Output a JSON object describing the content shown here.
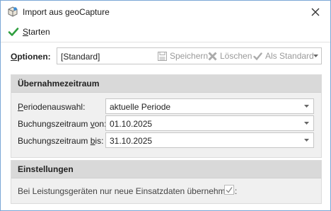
{
  "window": {
    "title": "Import aus geoCapture",
    "close_icon": "close-icon"
  },
  "toolbar": {
    "start_label_first": "S",
    "start_label_rest": "tarten",
    "start_icon": "checkmark-icon"
  },
  "options": {
    "label_first": "O",
    "label_rest": "ptionen:",
    "value": "[Standard]",
    "save_label": "Speichern",
    "delete_label": "Löschen",
    "default_label": "Als Standard"
  },
  "period_group": {
    "title": "Übernahmezeitraum",
    "period_label_first": "P",
    "period_label_rest": "eriodenauswahl:",
    "period_value": "aktuelle Periode",
    "from_label_pre": "Buchungszeitraum ",
    "from_label_u": "v",
    "from_label_post": "on:",
    "from_value": "01.10.2025",
    "to_label_pre": "Buchungszeitraum ",
    "to_label_u": "b",
    "to_label_post": "is:",
    "to_value": "31.10.2025"
  },
  "settings_group": {
    "title": "Einstellungen",
    "checkbox_label": "Bei Leistungsgeräten nur neue Einsatzdaten übernehmen:",
    "checkbox_checked": true
  },
  "colors": {
    "accent_green": "#2e9e3e",
    "disabled_gray": "#9a9a9a",
    "window_border": "#7aa7d6"
  }
}
